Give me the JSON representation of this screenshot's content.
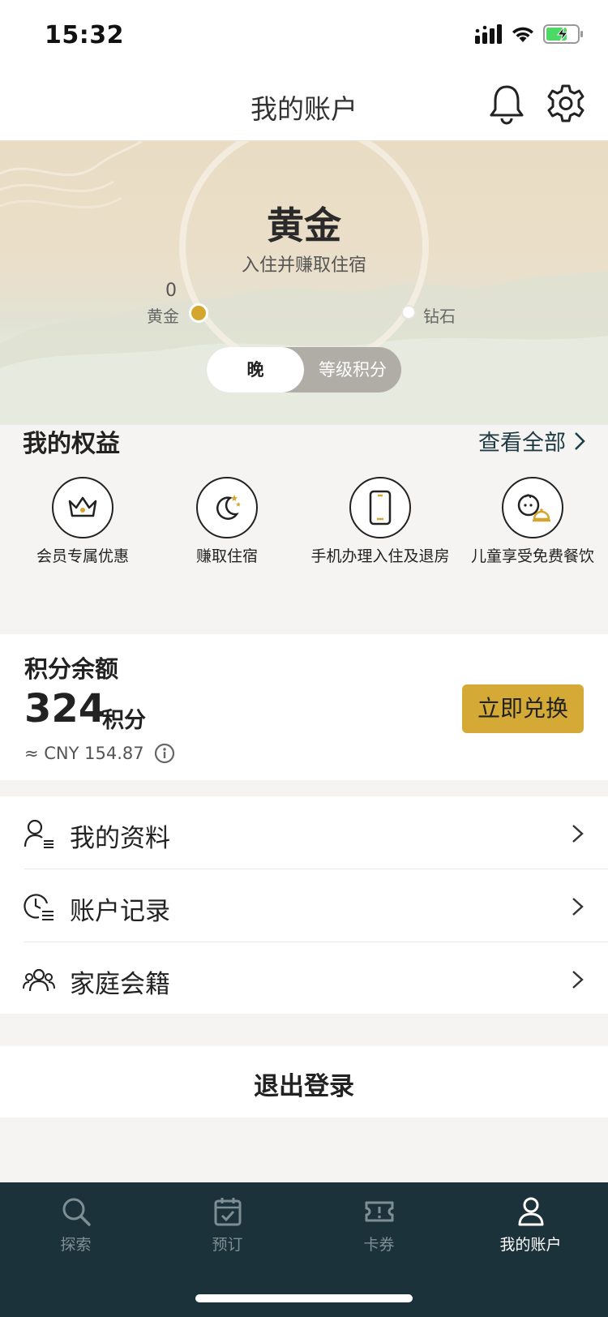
{
  "status": {
    "time": "15:32",
    "battery_color": "#4cd964"
  },
  "header": {
    "title": "我的账户",
    "bell_icon": "bell-icon",
    "settings_icon": "gear-icon"
  },
  "tier": {
    "name": "黄金",
    "subtitle": "入住并赚取住宿",
    "progress_value": "0",
    "from_label": "黄金",
    "to_label": "钻石",
    "toggle": {
      "active": "晚",
      "inactive": "等级积分"
    },
    "accent_color": "#d4a62d"
  },
  "benefits": {
    "title": "我的权益",
    "see_all": "查看全部",
    "items": [
      {
        "label": "会员专属优惠",
        "icon": "crown-icon"
      },
      {
        "label": "赚取住宿",
        "icon": "moon-stars-icon"
      },
      {
        "label": "手机办理入住及退房",
        "icon": "phone-icon"
      },
      {
        "label": "儿童享受免费餐饮",
        "icon": "child-dining-icon"
      }
    ]
  },
  "points": {
    "title": "积分余额",
    "value": "324",
    "unit": "积分",
    "cny": "≈ CNY 154.87",
    "redeem_label": "立即兑换",
    "button_color": "#d5a935"
  },
  "menu": {
    "items": [
      {
        "label": "我的资料",
        "icon": "profile-list-icon"
      },
      {
        "label": "账户记录",
        "icon": "clock-list-icon"
      },
      {
        "label": "家庭会籍",
        "icon": "family-icon"
      }
    ]
  },
  "logout": {
    "label": "退出登录"
  },
  "tabbar": {
    "background": "#1c323a",
    "tabs": [
      {
        "label": "探索",
        "icon": "search-icon",
        "active": false
      },
      {
        "label": "预订",
        "icon": "calendar-check-icon",
        "active": false
      },
      {
        "label": "卡券",
        "icon": "ticket-icon",
        "active": false
      },
      {
        "label": "我的账户",
        "icon": "user-icon",
        "active": true
      }
    ]
  }
}
